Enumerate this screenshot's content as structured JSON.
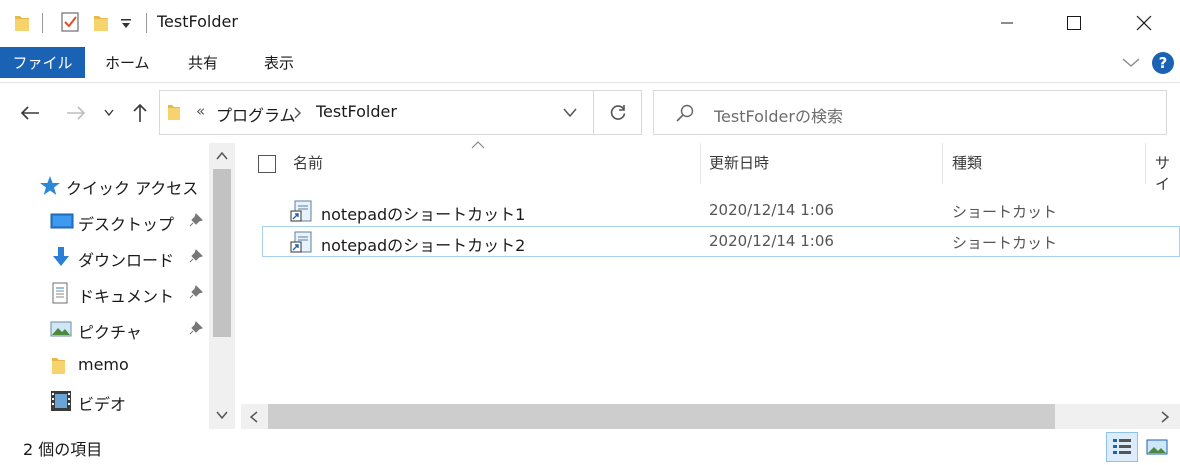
{
  "window": {
    "title": "TestFolder"
  },
  "ribbon": {
    "tabs": [
      "ファイル",
      "ホーム",
      "共有",
      "表示"
    ],
    "help_label": "?"
  },
  "address": {
    "overflow": "«",
    "crumbs": [
      "プログラム",
      "TestFolder"
    ]
  },
  "search": {
    "placeholder": "TestFolderの検索"
  },
  "sidebar": {
    "quick_access": "クイック アクセス",
    "items": [
      {
        "label": "デスクトップ",
        "icon": "desktop-icon",
        "pinned": true
      },
      {
        "label": "ダウンロード",
        "icon": "download-icon",
        "pinned": true
      },
      {
        "label": "ドキュメント",
        "icon": "document-icon",
        "pinned": true
      },
      {
        "label": "ピクチャ",
        "icon": "picture-icon",
        "pinned": true
      },
      {
        "label": "memo",
        "icon": "folder-icon",
        "pinned": false
      },
      {
        "label": "ビデオ",
        "icon": "video-icon",
        "pinned": false
      }
    ]
  },
  "columns": {
    "name": "名前",
    "modified": "更新日時",
    "type": "種類",
    "size": "サイ"
  },
  "files": [
    {
      "name": "notepadのショートカット1",
      "modified": "2020/12/14 1:06",
      "type": "ショートカット",
      "selected": false
    },
    {
      "name": "notepadのショートカット2",
      "modified": "2020/12/14 1:06",
      "type": "ショートカット",
      "selected": true
    }
  ],
  "status": {
    "item_count": "2 個の項目"
  },
  "colors": {
    "accent": "#1a62b3",
    "folder": "#e8b94a",
    "selection_border": "#a8d2f0"
  }
}
